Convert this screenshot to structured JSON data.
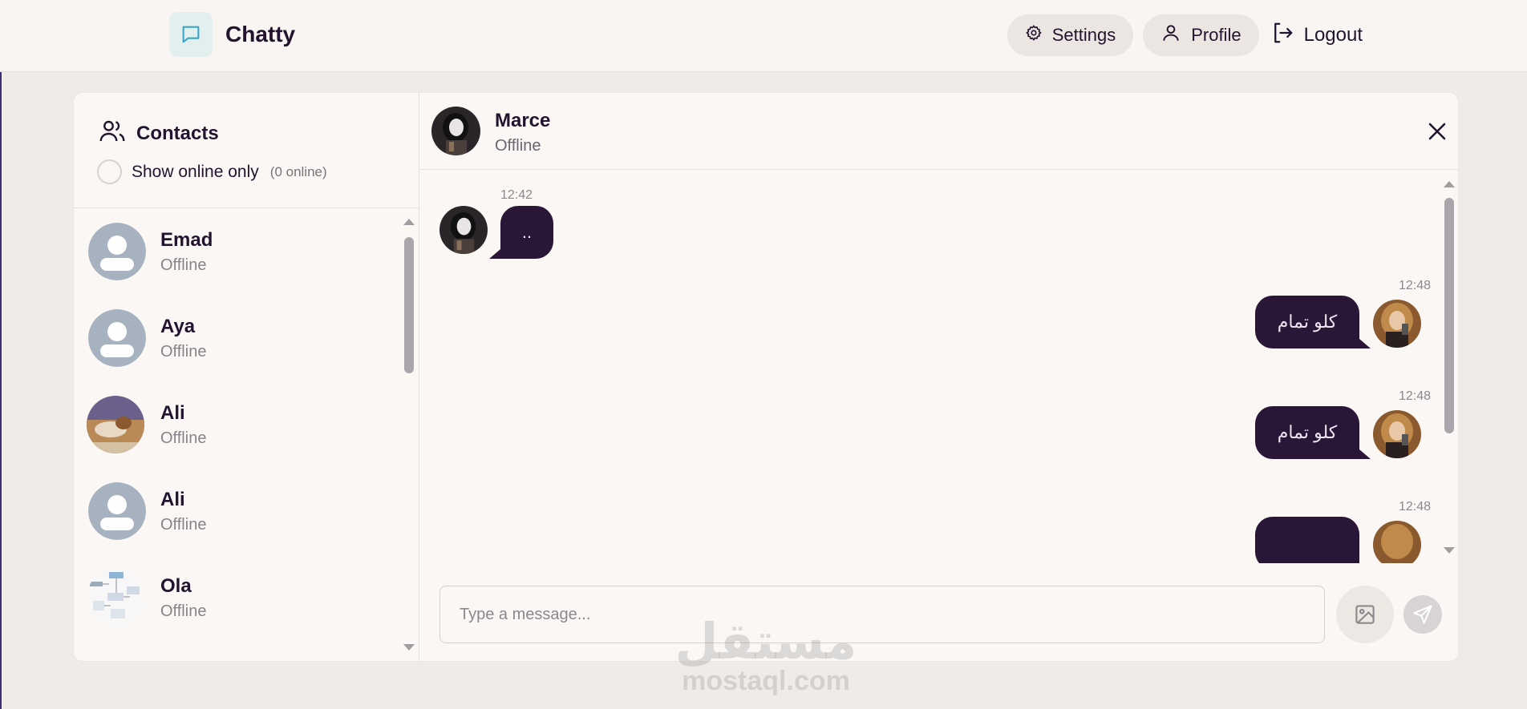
{
  "app": {
    "name": "Chatty"
  },
  "nav": {
    "settings_label": "Settings",
    "profile_label": "Profile",
    "logout_label": "Logout"
  },
  "sidebar": {
    "title": "Contacts",
    "online_filter_label": "Show online only",
    "online_count": "(0 online)",
    "contacts": [
      {
        "name": "Emad",
        "status": "Offline",
        "avatar": "default-avatar"
      },
      {
        "name": "Aya",
        "status": "Offline",
        "avatar": "default-avatar"
      },
      {
        "name": "Ali",
        "status": "Offline",
        "avatar": "photo-avatar"
      },
      {
        "name": "Ali",
        "status": "Offline",
        "avatar": "default-avatar"
      },
      {
        "name": "Ola",
        "status": "Offline",
        "avatar": "diagram-avatar"
      }
    ]
  },
  "chat": {
    "contact_name": "Marce",
    "contact_status": "Offline",
    "messages": [
      {
        "direction": "incoming",
        "time": "12:42",
        "text": ".."
      },
      {
        "direction": "outgoing",
        "time": "12:48",
        "text": "كلو تمام"
      },
      {
        "direction": "outgoing",
        "time": "12:48",
        "text": "كلو تمام"
      },
      {
        "direction": "outgoing",
        "time": "12:48",
        "text": ""
      }
    ],
    "composer": {
      "placeholder": "Type a message..."
    }
  },
  "watermark": {
    "arabic": "مستقل",
    "latin": "mostaql.com"
  },
  "colors": {
    "bubble": "#2a1637",
    "background": "#efebe7",
    "card": "#faf7f5",
    "accent_logo_bg": "#e3efef"
  }
}
